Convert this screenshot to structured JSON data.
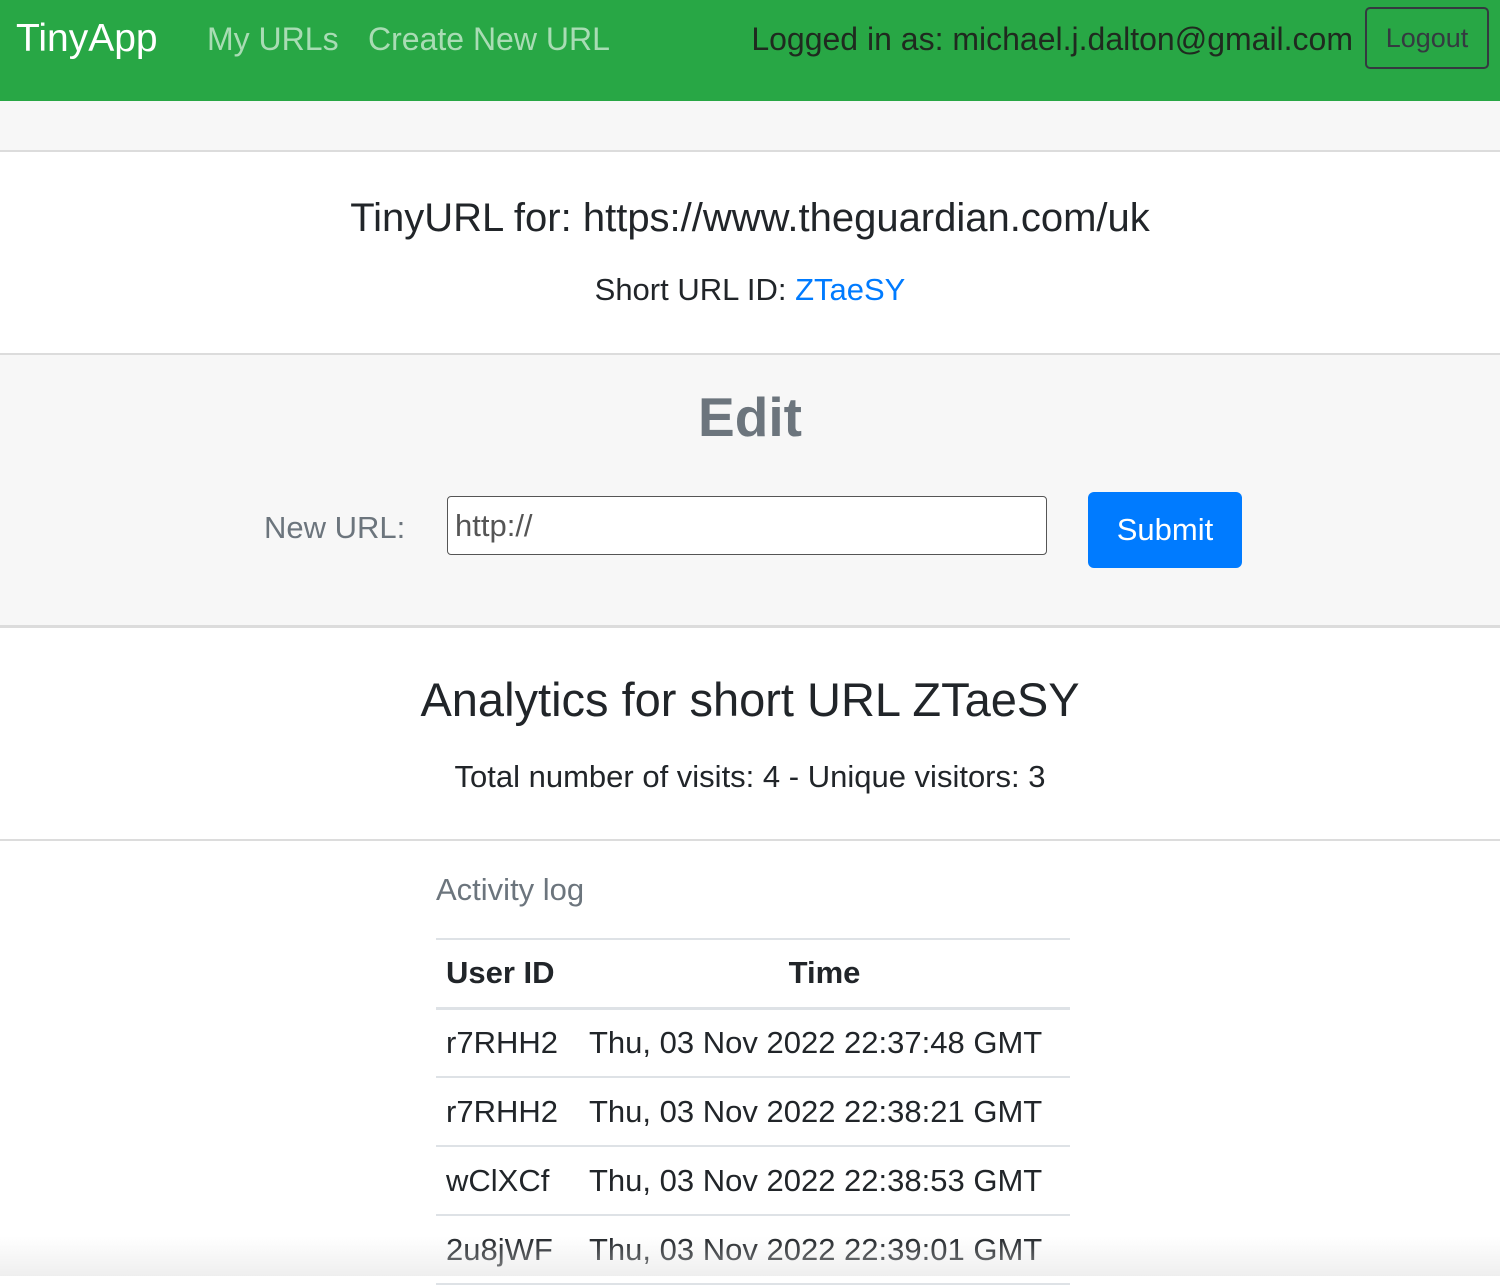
{
  "navbar": {
    "brand": "TinyApp",
    "links": [
      {
        "label": "My URLs"
      },
      {
        "label": "Create New URL"
      }
    ],
    "logged_in_text": "Logged in as: michael.j.dalton@gmail.com",
    "logout_label": "Logout"
  },
  "url_info": {
    "title": "TinyURL for: https://www.theguardian.com/uk",
    "short_id_label": "Short URL ID: ",
    "short_id": "ZTaeSY"
  },
  "edit": {
    "heading": "Edit",
    "new_url_label": "New URL:",
    "input_placeholder": "http://",
    "input_value": "",
    "submit_label": "Submit"
  },
  "analytics": {
    "title": "Analytics for short URL ZTaeSY",
    "summary": "Total number of visits: 4 - Unique visitors: 3"
  },
  "activity_log": {
    "label": "Activity log",
    "columns": [
      "User ID",
      "Time"
    ],
    "rows": [
      {
        "user_id": "r7RHH2",
        "time": "Thu, 03 Nov 2022 22:37:48 GMT"
      },
      {
        "user_id": "r7RHH2",
        "time": "Thu, 03 Nov 2022 22:38:21 GMT"
      },
      {
        "user_id": "wClXCf",
        "time": "Thu, 03 Nov 2022 22:38:53 GMT"
      },
      {
        "user_id": "2u8jWF",
        "time": "Thu, 03 Nov 2022 22:39:01 GMT"
      }
    ]
  },
  "colors": {
    "navbar_bg": "#28a745",
    "primary": "#007bff",
    "muted_text": "#6c757d"
  }
}
